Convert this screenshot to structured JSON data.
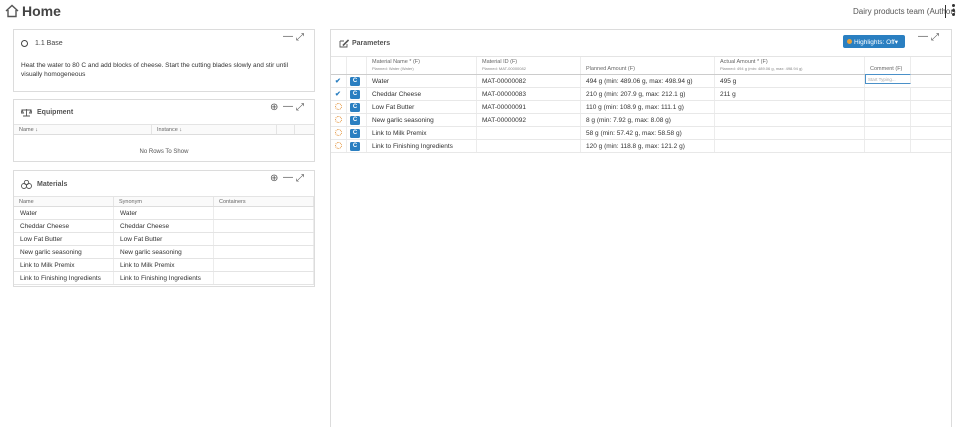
{
  "header": {
    "title": "Home",
    "team": "Dairy products team (Author)"
  },
  "base": {
    "title": "1.1 Base",
    "instruction": "Heat the water to 80 C and add blocks of cheese. Start the cutting blades slowly and stir until visually homogeneous"
  },
  "equipment": {
    "title": "Equipment",
    "columns": [
      "Name ↓",
      "Instance ↓"
    ],
    "empty_text": "No Rows To Show"
  },
  "materials": {
    "title": "Materials",
    "columns": [
      "Name",
      "Synonym",
      "Containers"
    ],
    "rows": [
      [
        "Water",
        "Water",
        ""
      ],
      [
        "Cheddar Cheese",
        "Cheddar Cheese",
        ""
      ],
      [
        "Low Fat Butter",
        "Low Fat Butter",
        ""
      ],
      [
        "New garlic seasoning",
        "New garlic seasoning",
        ""
      ],
      [
        "Link to Milk Premix",
        "Link to Milk Premix",
        ""
      ],
      [
        "Link to Finishing Ingredients",
        "Link to Finishing Ingredients",
        ""
      ]
    ]
  },
  "parameters": {
    "title": "Parameters",
    "highlights_label": "Highlights: Off▾",
    "columns": {
      "name": "Material Name * (F)",
      "name_sub": "Planned: Water (Water)",
      "id": "Material ID (F)",
      "id_sub": "Planned: MAT-00000082",
      "planned": "Planned Amount (F)",
      "actual": "Actual Amount * (F)",
      "actual_sub": "Planned: 494 g (min: 489.06 g, max: 498.94 g)",
      "comment": "Comment (F)"
    },
    "comment_placeholder": "Start Typing...",
    "rows": [
      {
        "status": "done",
        "name": "Water",
        "id": "MAT-00000082",
        "planned": "494 g (min: 489.06 g, max: 498.94 g)",
        "actual": "495 g"
      },
      {
        "status": "done",
        "name": "Cheddar Cheese",
        "id": "MAT-00000083",
        "planned": "210 g (min: 207.9 g, max: 212.1 g)",
        "actual": "211 g"
      },
      {
        "status": "pending",
        "name": "Low Fat Butter",
        "id": "MAT-00000091",
        "planned": "110 g (min: 108.9 g, max: 111.1 g)",
        "actual": ""
      },
      {
        "status": "pending",
        "name": "New garlic seasoning",
        "id": "MAT-00000092",
        "planned": "8 g (min: 7.92 g, max: 8.08 g)",
        "actual": ""
      },
      {
        "status": "pending",
        "name": "Link to Milk Premix",
        "id": "",
        "planned": "58 g (min: 57.42 g, max: 58.58 g)",
        "actual": ""
      },
      {
        "status": "pending",
        "name": "Link to Finishing Ingredients",
        "id": "",
        "planned": "120 g (min: 118.8 g, max: 121.2 g)",
        "actual": ""
      }
    ]
  },
  "colors": {
    "accent": "#2a7fc1",
    "pending": "#e08a2b"
  }
}
